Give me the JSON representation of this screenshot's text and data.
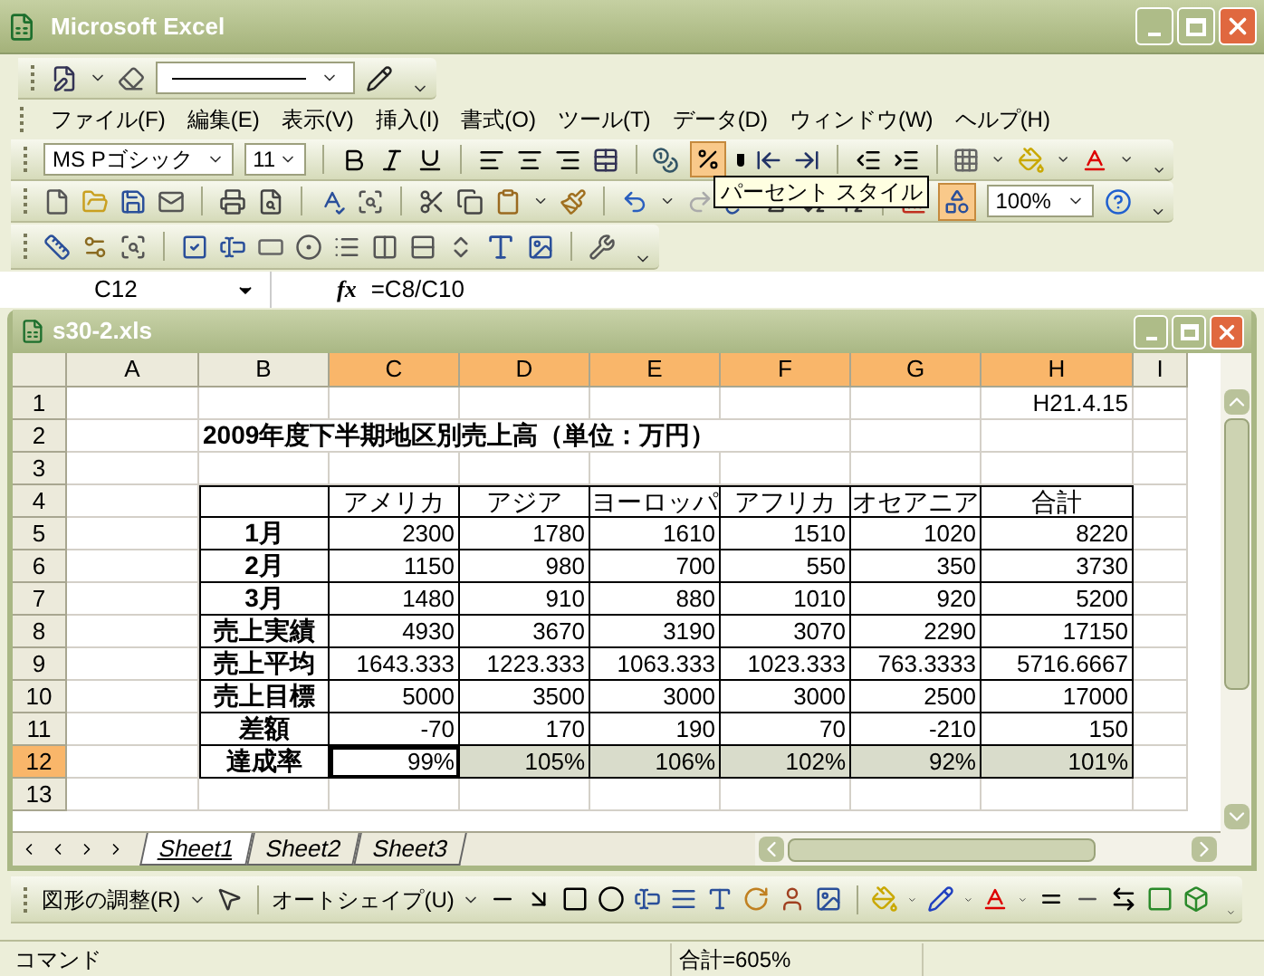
{
  "app_title": "Microsoft Excel",
  "menu": [
    "ファイル(F)",
    "編集(E)",
    "表示(V)",
    "挿入(I)",
    "書式(O)",
    "ツール(T)",
    "データ(D)",
    "ウィンドウ(W)",
    "ヘルプ(H)"
  ],
  "format_toolbar": {
    "font": "MS Pゴシック",
    "size": "11",
    "percent_pressed": true
  },
  "tooltip": "パーセント スタイル",
  "standard_toolbar": {
    "zoom": "100%",
    "drawing_pressed": true
  },
  "formula_bar": {
    "name_box": "C12",
    "fx": "fx",
    "formula": "=C8/C10"
  },
  "workbook": {
    "title": "s30-2.xls",
    "columns": [
      {
        "label": "A",
        "selected": false
      },
      {
        "label": "B",
        "selected": false
      },
      {
        "label": "C",
        "selected": true
      },
      {
        "label": "D",
        "selected": true
      },
      {
        "label": "E",
        "selected": true
      },
      {
        "label": "F",
        "selected": true
      },
      {
        "label": "G",
        "selected": true
      },
      {
        "label": "H",
        "selected": true
      },
      {
        "label": "I",
        "selected": false
      }
    ],
    "rows": [
      {
        "label": "1",
        "selected": false,
        "kind": "plain",
        "cells": {
          "H": "H21.4.15"
        }
      },
      {
        "label": "2",
        "selected": false,
        "kind": "title",
        "cells": {
          "B": "2009年度下半期地区別売上高（単位：万円）"
        }
      },
      {
        "label": "3",
        "selected": false,
        "kind": "plain",
        "cells": {}
      },
      {
        "label": "4",
        "selected": false,
        "kind": "header",
        "cells": {
          "C": "アメリカ",
          "D": "アジア",
          "E": "ヨーロッパ",
          "F": "アフリカ",
          "G": "オセアニア",
          "H": "合計"
        }
      },
      {
        "label": "5",
        "selected": false,
        "kind": "table",
        "cells": {
          "B": "1月",
          "C": "2300",
          "D": "1780",
          "E": "1610",
          "F": "1510",
          "G": "1020",
          "H": "8220"
        }
      },
      {
        "label": "6",
        "selected": false,
        "kind": "table",
        "cells": {
          "B": "2月",
          "C": "1150",
          "D": "980",
          "E": "700",
          "F": "550",
          "G": "350",
          "H": "3730"
        }
      },
      {
        "label": "7",
        "selected": false,
        "kind": "table",
        "cells": {
          "B": "3月",
          "C": "1480",
          "D": "910",
          "E": "880",
          "F": "1010",
          "G": "920",
          "H": "5200"
        }
      },
      {
        "label": "8",
        "selected": false,
        "kind": "table",
        "cells": {
          "B": "売上実績",
          "C": "4930",
          "D": "3670",
          "E": "3190",
          "F": "3070",
          "G": "2290",
          "H": "17150"
        }
      },
      {
        "label": "9",
        "selected": false,
        "kind": "table",
        "cells": {
          "B": "売上平均",
          "C": "1643.333",
          "D": "1223.333",
          "E": "1063.333",
          "F": "1023.333",
          "G": "763.3333",
          "H": "5716.6667"
        }
      },
      {
        "label": "10",
        "selected": false,
        "kind": "table",
        "cells": {
          "B": "売上目標",
          "C": "5000",
          "D": "3500",
          "E": "3000",
          "F": "3000",
          "G": "2500",
          "H": "17000"
        }
      },
      {
        "label": "11",
        "selected": false,
        "kind": "table",
        "cells": {
          "B": "差額",
          "C": "-70",
          "D": "170",
          "E": "190",
          "F": "70",
          "G": "-210",
          "H": "150"
        }
      },
      {
        "label": "12",
        "selected": true,
        "kind": "table",
        "cells": {
          "B": "達成率",
          "C": "99%",
          "D": "105%",
          "E": "106%",
          "F": "102%",
          "G": "92%",
          "H": "101%"
        }
      },
      {
        "label": "13",
        "selected": false,
        "kind": "plain",
        "cells": {}
      }
    ],
    "sheet_tabs": [
      {
        "label": "Sheet1",
        "selected": true
      },
      {
        "label": "Sheet2",
        "selected": false
      },
      {
        "label": "Sheet3",
        "selected": false
      }
    ]
  },
  "drawing_toolbar": {
    "adjust_menu": "図形の調整(R)",
    "autoshape_menu": "オートシェイプ(U)"
  },
  "status_bar": {
    "mode": "コマンド",
    "sum": "合計=605%"
  }
}
